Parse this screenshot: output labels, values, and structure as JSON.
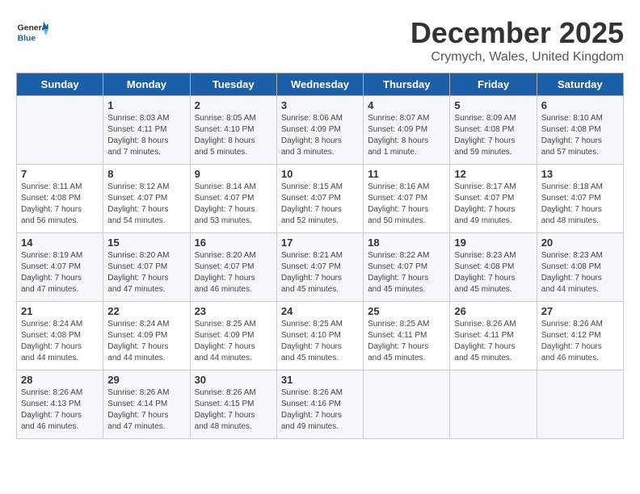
{
  "logo": {
    "general": "General",
    "blue": "Blue"
  },
  "title": "December 2025",
  "location": "Crymych, Wales, United Kingdom",
  "days_of_week": [
    "Sunday",
    "Monday",
    "Tuesday",
    "Wednesday",
    "Thursday",
    "Friday",
    "Saturday"
  ],
  "weeks": [
    [
      {
        "day": "",
        "info": ""
      },
      {
        "day": "1",
        "info": "Sunrise: 8:03 AM\nSunset: 4:11 PM\nDaylight: 8 hours\nand 7 minutes."
      },
      {
        "day": "2",
        "info": "Sunrise: 8:05 AM\nSunset: 4:10 PM\nDaylight: 8 hours\nand 5 minutes."
      },
      {
        "day": "3",
        "info": "Sunrise: 8:06 AM\nSunset: 4:09 PM\nDaylight: 8 hours\nand 3 minutes."
      },
      {
        "day": "4",
        "info": "Sunrise: 8:07 AM\nSunset: 4:09 PM\nDaylight: 8 hours\nand 1 minute."
      },
      {
        "day": "5",
        "info": "Sunrise: 8:09 AM\nSunset: 4:08 PM\nDaylight: 7 hours\nand 59 minutes."
      },
      {
        "day": "6",
        "info": "Sunrise: 8:10 AM\nSunset: 4:08 PM\nDaylight: 7 hours\nand 57 minutes."
      }
    ],
    [
      {
        "day": "7",
        "info": "Sunrise: 8:11 AM\nSunset: 4:08 PM\nDaylight: 7 hours\nand 56 minutes."
      },
      {
        "day": "8",
        "info": "Sunrise: 8:12 AM\nSunset: 4:07 PM\nDaylight: 7 hours\nand 54 minutes."
      },
      {
        "day": "9",
        "info": "Sunrise: 8:14 AM\nSunset: 4:07 PM\nDaylight: 7 hours\nand 53 minutes."
      },
      {
        "day": "10",
        "info": "Sunrise: 8:15 AM\nSunset: 4:07 PM\nDaylight: 7 hours\nand 52 minutes."
      },
      {
        "day": "11",
        "info": "Sunrise: 8:16 AM\nSunset: 4:07 PM\nDaylight: 7 hours\nand 50 minutes."
      },
      {
        "day": "12",
        "info": "Sunrise: 8:17 AM\nSunset: 4:07 PM\nDaylight: 7 hours\nand 49 minutes."
      },
      {
        "day": "13",
        "info": "Sunrise: 8:18 AM\nSunset: 4:07 PM\nDaylight: 7 hours\nand 48 minutes."
      }
    ],
    [
      {
        "day": "14",
        "info": "Sunrise: 8:19 AM\nSunset: 4:07 PM\nDaylight: 7 hours\nand 47 minutes."
      },
      {
        "day": "15",
        "info": "Sunrise: 8:20 AM\nSunset: 4:07 PM\nDaylight: 7 hours\nand 47 minutes."
      },
      {
        "day": "16",
        "info": "Sunrise: 8:20 AM\nSunset: 4:07 PM\nDaylight: 7 hours\nand 46 minutes."
      },
      {
        "day": "17",
        "info": "Sunrise: 8:21 AM\nSunset: 4:07 PM\nDaylight: 7 hours\nand 45 minutes."
      },
      {
        "day": "18",
        "info": "Sunrise: 8:22 AM\nSunset: 4:07 PM\nDaylight: 7 hours\nand 45 minutes."
      },
      {
        "day": "19",
        "info": "Sunrise: 8:23 AM\nSunset: 4:08 PM\nDaylight: 7 hours\nand 45 minutes."
      },
      {
        "day": "20",
        "info": "Sunrise: 8:23 AM\nSunset: 4:08 PM\nDaylight: 7 hours\nand 44 minutes."
      }
    ],
    [
      {
        "day": "21",
        "info": "Sunrise: 8:24 AM\nSunset: 4:08 PM\nDaylight: 7 hours\nand 44 minutes."
      },
      {
        "day": "22",
        "info": "Sunrise: 8:24 AM\nSunset: 4:09 PM\nDaylight: 7 hours\nand 44 minutes."
      },
      {
        "day": "23",
        "info": "Sunrise: 8:25 AM\nSunset: 4:09 PM\nDaylight: 7 hours\nand 44 minutes."
      },
      {
        "day": "24",
        "info": "Sunrise: 8:25 AM\nSunset: 4:10 PM\nDaylight: 7 hours\nand 45 minutes."
      },
      {
        "day": "25",
        "info": "Sunrise: 8:25 AM\nSunset: 4:11 PM\nDaylight: 7 hours\nand 45 minutes."
      },
      {
        "day": "26",
        "info": "Sunrise: 8:26 AM\nSunset: 4:11 PM\nDaylight: 7 hours\nand 45 minutes."
      },
      {
        "day": "27",
        "info": "Sunrise: 8:26 AM\nSunset: 4:12 PM\nDaylight: 7 hours\nand 46 minutes."
      }
    ],
    [
      {
        "day": "28",
        "info": "Sunrise: 8:26 AM\nSunset: 4:13 PM\nDaylight: 7 hours\nand 46 minutes."
      },
      {
        "day": "29",
        "info": "Sunrise: 8:26 AM\nSunset: 4:14 PM\nDaylight: 7 hours\nand 47 minutes."
      },
      {
        "day": "30",
        "info": "Sunrise: 8:26 AM\nSunset: 4:15 PM\nDaylight: 7 hours\nand 48 minutes."
      },
      {
        "day": "31",
        "info": "Sunrise: 8:26 AM\nSunset: 4:16 PM\nDaylight: 7 hours\nand 49 minutes."
      },
      {
        "day": "",
        "info": ""
      },
      {
        "day": "",
        "info": ""
      },
      {
        "day": "",
        "info": ""
      }
    ]
  ]
}
